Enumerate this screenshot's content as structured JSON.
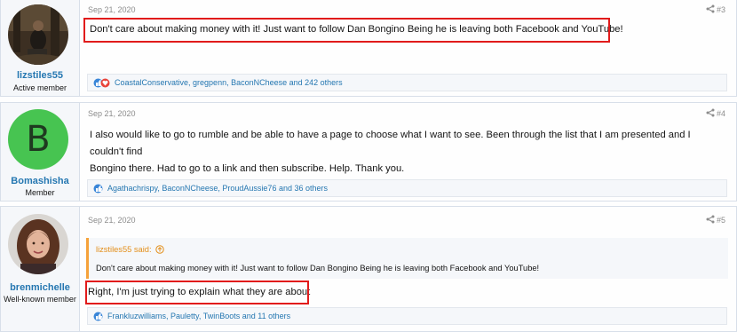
{
  "posts": [
    {
      "username": "lizstiles55",
      "user_title": "Active member",
      "date": "Sep 21, 2020",
      "post_number": "#3",
      "message": "Don't care about making money with it! Just want to follow Dan Bongino Being he is leaving both Facebook and YouTube!",
      "reactions": "CoastalConservative, gregpenn, BaconNCheese and 242 others"
    },
    {
      "username": "Bomashisha",
      "user_title": "Member",
      "avatar_letter": "B",
      "date": "Sep 21, 2020",
      "post_number": "#4",
      "message_lines": [
        "I also would like to go to rumble and be able to have a page to choose what I want to see. Been through the list that I am presented and I couldn't find",
        "Bongino there. Had to go to a link and then subscribe. Help. Thank you."
      ],
      "reactions": "Agathachrispy, BaconNCheese, ProudAussie76 and 36 others"
    },
    {
      "username": "brenmichelle",
      "user_title": "Well-known member",
      "date": "Sep 21, 2020",
      "post_number": "#5",
      "quote": {
        "attribution": "lizstiles55 said:",
        "text": "Don't care about making money with it! Just want to follow Dan Bongino Being he is leaving both Facebook and YouTube!"
      },
      "message": "Right, I'm just trying to explain what they are about",
      "reactions": "Frankluzwilliams, Pauletty, TwinBoots and 11 others"
    }
  ],
  "colors": {
    "link": "#2577b1",
    "highlight_box": "#e11b1b",
    "quote_accent": "#f6a23a",
    "avatar_green": "#47c451"
  },
  "icons": [
    "share-icon",
    "like-icon",
    "love-icon",
    "quote-arrow-icon"
  ]
}
